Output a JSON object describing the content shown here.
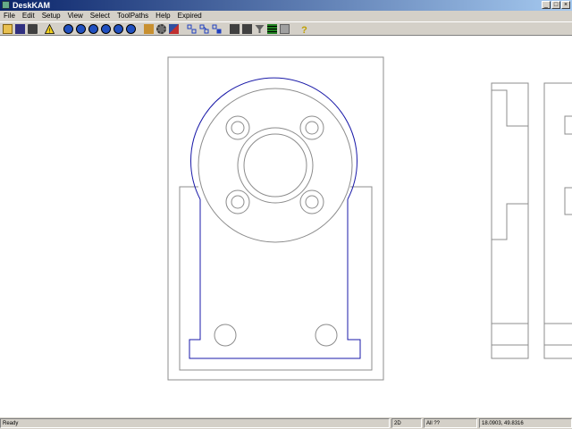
{
  "window": {
    "title": "DeskKAM"
  },
  "menu": [
    "File",
    "Edit",
    "Setup",
    "View",
    "Select",
    "ToolPaths",
    "Help",
    "Expired"
  ],
  "toolbar": {
    "buttons": [
      "open-icon",
      "save-icon",
      "print-icon",
      "warning-icon",
      "zoom-all-icon",
      "zoom-in-icon",
      "zoom-out-icon",
      "zoom-window-icon",
      "zoom-prev-icon",
      "zoom-fit-icon",
      "tool-library-icon",
      "settings-icon",
      "cut-icon",
      "select-icon",
      "select-chain-icon",
      "select-all-icon",
      "machine-icon",
      "machine-setup-icon",
      "filter-icon",
      "layers-icon",
      "grid-icon",
      "help-icon"
    ]
  },
  "status": {
    "message": "Ready",
    "mode": "2D",
    "selection": "All ??",
    "coords": "18.0903, 49.8316"
  },
  "colors": {
    "selected": "#1a1aa8",
    "geometry": "#8c8c8c"
  }
}
